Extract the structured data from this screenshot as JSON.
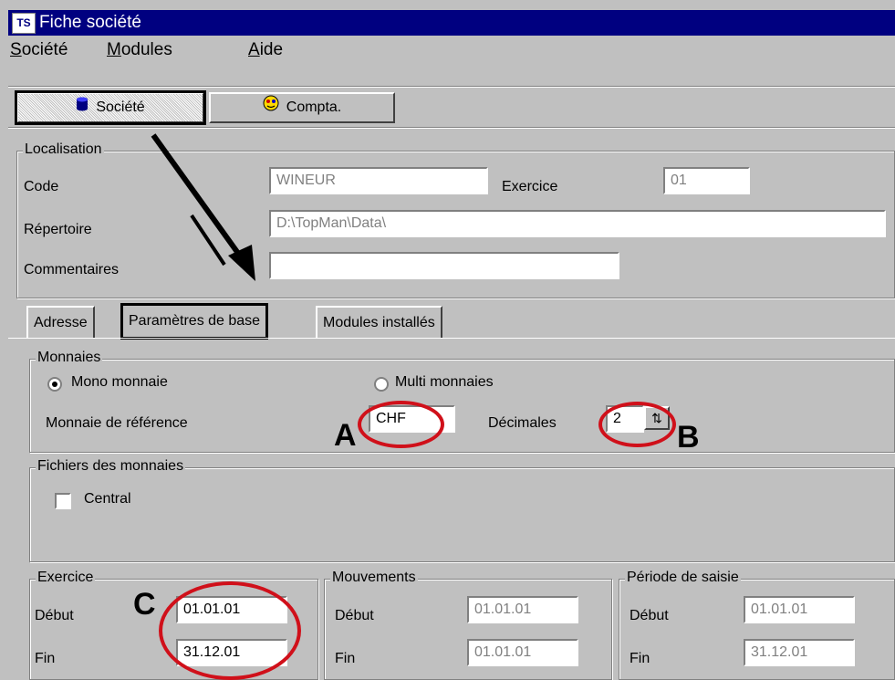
{
  "window": {
    "title": "Fiche société"
  },
  "menu": [
    {
      "label": "Société",
      "mnemonic": "S"
    },
    {
      "label": "Modules",
      "mnemonic": "M"
    },
    {
      "label": "Aide",
      "mnemonic": "A"
    }
  ],
  "toolbar": {
    "societe_label": "Société",
    "compta_label": "Compta."
  },
  "localisation": {
    "group_label": "Localisation",
    "code_label": "Code",
    "code_value": "WINEUR",
    "exercice_label": "Exercice",
    "exercice_value": "01",
    "repertoire_label": "Répertoire",
    "repertoire_value": "D:\\TopMan\\Data\\",
    "commentaires_label": "Commentaires",
    "commentaires_value": ""
  },
  "tabs": [
    {
      "label": "Adresse",
      "active": false
    },
    {
      "label": "Paramètres de base",
      "active": true
    },
    {
      "label": "Modules installés",
      "active": false
    }
  ],
  "monnaies": {
    "group_label": "Monnaies",
    "mono_label": "Mono monnaie",
    "mono_checked": true,
    "multi_label": "Multi monnaies",
    "multi_checked": false,
    "reference_label": "Monnaie de référence",
    "reference_value": "CHF",
    "decimales_label": "Décimales",
    "decimales_value": "2"
  },
  "fichiers": {
    "group_label": "Fichiers des monnaies",
    "central_label": "Central",
    "central_checked": false
  },
  "exercice": {
    "group_label": "Exercice",
    "debut_label": "Début",
    "debut_value": "01.01.01",
    "fin_label": "Fin",
    "fin_value": "31.12.01"
  },
  "mouvements": {
    "group_label": "Mouvements",
    "debut_label": "Début",
    "debut_value": "01.01.01",
    "fin_label": "Fin",
    "fin_value": "01.01.01"
  },
  "periode": {
    "group_label": "Période de saisie",
    "debut_label": "Début",
    "debut_value": "01.01.01",
    "fin_label": "Fin",
    "fin_value": "31.12.01"
  },
  "annotations": {
    "A": "A",
    "B": "B",
    "C": "C",
    "color": "#d0101a"
  }
}
